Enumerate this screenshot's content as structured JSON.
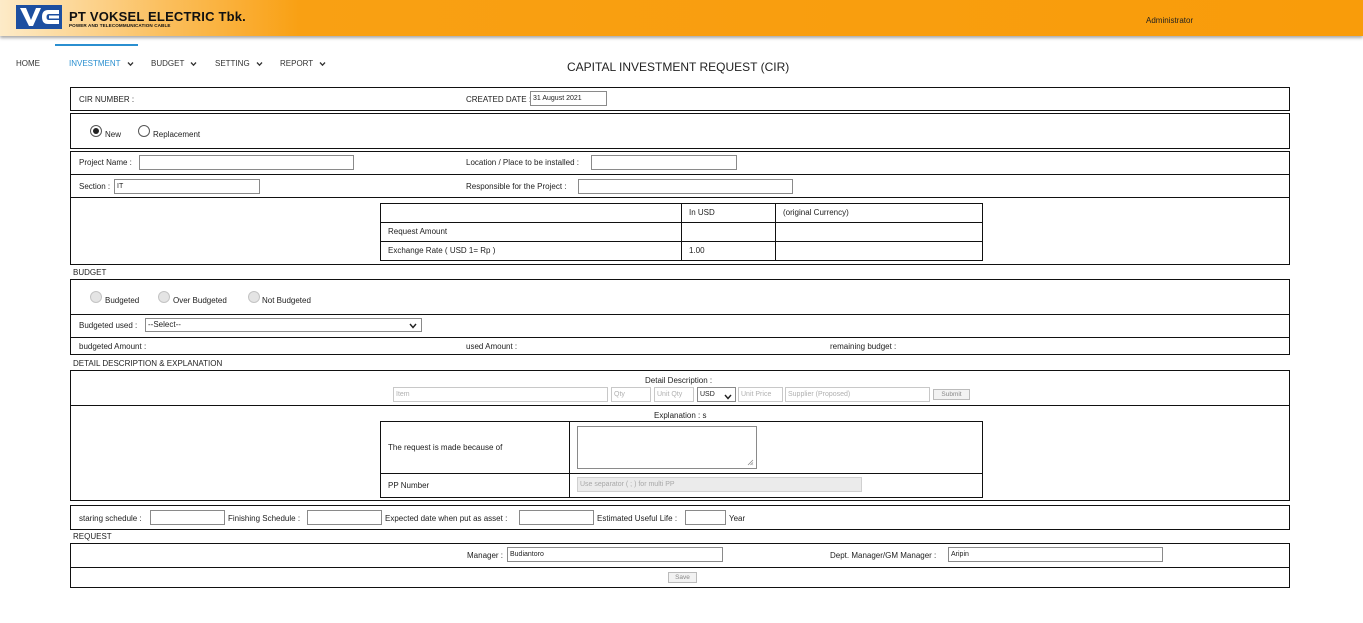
{
  "header": {
    "company_name": "PT VOKSEL ELECTRIC Tbk.",
    "company_tagline": "POWER AND TELECOMMUNICATION CABLE",
    "user": "Administrator",
    "brand_color": "#f99c0a"
  },
  "nav": {
    "items": [
      {
        "label": "HOME"
      },
      {
        "label": "INVESTMENT"
      },
      {
        "label": "BUDGET"
      },
      {
        "label": "SETTING"
      },
      {
        "label": "REPORT"
      }
    ],
    "active": "INVESTMENT",
    "accent_color": "#2a8fd0"
  },
  "page_title": "CAPITAL INVESTMENT REQUEST (CIR)",
  "cir": {
    "number_label": "CIR NUMBER :",
    "created_date_label": "CREATED DATE :",
    "created_date_value": "31 August 2021"
  },
  "request_type": {
    "options": [
      {
        "label": "New",
        "checked": true
      },
      {
        "label": "Replacement",
        "checked": false
      }
    ]
  },
  "project": {
    "name_label": "Project Name :",
    "name_value": "",
    "location_label": "Location / Place to be installed :",
    "location_value": "",
    "section_label": "Section :",
    "section_value": "IT",
    "responsible_label": "Responsible for the Project :",
    "responsible_value": ""
  },
  "amount_table": {
    "headers": [
      "",
      "In USD",
      "(original Currency)"
    ],
    "rows": [
      {
        "label": "Request Amount",
        "usd": "",
        "original": ""
      },
      {
        "label": "Exchange Rate ( USD 1= Rp )",
        "usd": "1.00",
        "original": ""
      }
    ]
  },
  "budget": {
    "section_title": "BUDGET",
    "options": [
      {
        "label": "Budgeted"
      },
      {
        "label": "Over Budgeted"
      },
      {
        "label": "Not Budgeted"
      }
    ],
    "used_label": "Budgeted used :",
    "used_selected": "--Select--",
    "budgeted_amount_label": "budgeted Amount :",
    "used_amount_label": "used Amount :",
    "remaining_label": "remaining budget :"
  },
  "detail": {
    "section_title": "DETAIL DESCRIPTION & EXPLANATION",
    "description_title": "Detail Description :",
    "item_placeholder": "Item",
    "qty_placeholder": "Qty",
    "unit_qty_placeholder": "Unit Qty",
    "currency_selected": "USD",
    "unit_price_placeholder": "Unit Price",
    "supplier_placeholder": "Supplier (Proposed)",
    "submit_label": "Submit",
    "explanation_title": "Explanation : s",
    "reason_label": "The request is made because of",
    "pp_label": "PP Number",
    "pp_placeholder": "Use separator ( ; ) for multi PP"
  },
  "schedule": {
    "starting_label": "staring schedule :",
    "finishing_label": "Finishing Schedule :",
    "expected_label": "Expected date when put as asset :",
    "useful_life_label": "Estimated Useful Life :",
    "year_label": "Year"
  },
  "request": {
    "section_title": "REQUEST",
    "manager_label": "Manager :",
    "manager_value": "Budiantoro",
    "dept_manager_label": "Dept. Manager/GM Manager :",
    "dept_manager_value": "Aripin",
    "save_label": "Save"
  }
}
